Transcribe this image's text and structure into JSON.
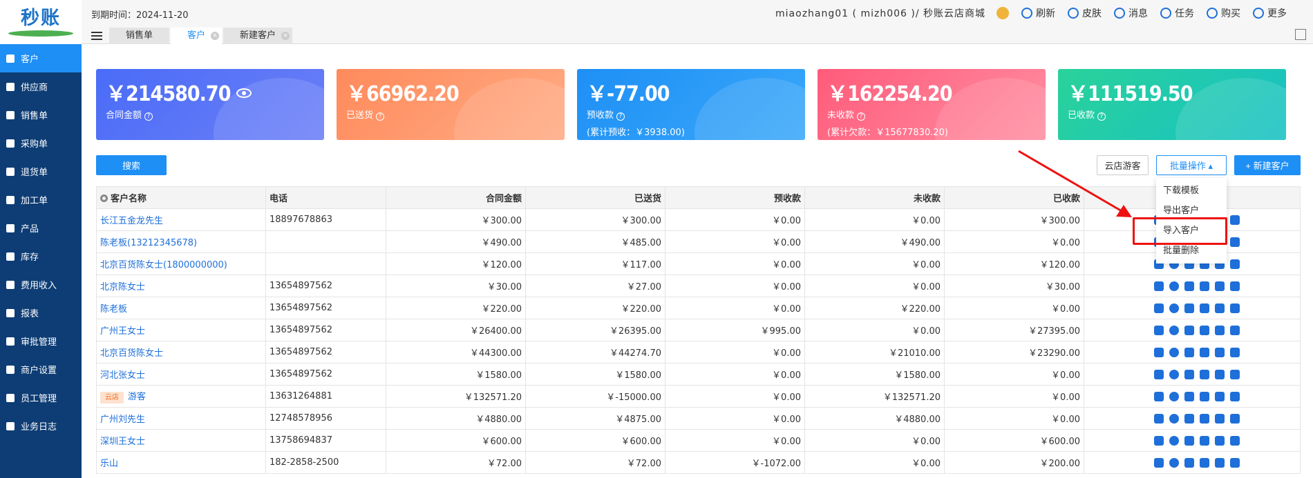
{
  "logo": {
    "text": "秒账"
  },
  "sidebar": {
    "items": [
      {
        "label": "客户",
        "active": true
      },
      {
        "label": "供应商"
      },
      {
        "label": "销售单"
      },
      {
        "label": "采购单"
      },
      {
        "label": "退货单"
      },
      {
        "label": "加工单"
      },
      {
        "label": "产品"
      },
      {
        "label": "库存"
      },
      {
        "label": "费用收入"
      },
      {
        "label": "报表"
      },
      {
        "label": "审批管理"
      },
      {
        "label": "商户设置"
      },
      {
        "label": "员工管理"
      },
      {
        "label": "业务日志"
      }
    ]
  },
  "header": {
    "expire": "到期时间：2024-11-20",
    "account": "miaozhang01 ( mizh006 )/ 秒账云店商城",
    "tools": [
      {
        "label": "刷新",
        "icon": "refresh-icon"
      },
      {
        "label": "皮肤",
        "icon": "palette-icon"
      },
      {
        "label": "消息",
        "icon": "message-icon"
      },
      {
        "label": "任务",
        "icon": "download-icon"
      },
      {
        "label": "购买",
        "icon": "cart-icon"
      },
      {
        "label": "更多",
        "icon": "user-icon"
      }
    ],
    "tabs": [
      {
        "label": "销售单"
      },
      {
        "label": "客户",
        "active": true
      },
      {
        "label": "新建客户"
      }
    ]
  },
  "cards": [
    {
      "amount": "￥214580.70",
      "label": "合同金额"
    },
    {
      "amount": "￥66962.20",
      "label": "已送货"
    },
    {
      "amount": "￥-77.00",
      "label": "预收款",
      "sub": "(累计预收：￥3938.00)"
    },
    {
      "amount": "￥162254.20",
      "label": "未收款",
      "sub": "(累计欠款：￥15677830.20)"
    },
    {
      "amount": "￥111519.50",
      "label": "已收款"
    }
  ],
  "toolbar": {
    "search": "搜索",
    "visitor": "云店游客",
    "batch": "批量操作 ▴",
    "new_customer": "+ 新建客户"
  },
  "dropdown": [
    "下载模板",
    "导出客户",
    "导入客户",
    "批量删除"
  ],
  "table": {
    "headers": [
      "客户名称",
      "电话",
      "合同金额",
      "已送货",
      "预收款",
      "未收款",
      "已收款"
    ],
    "rows": [
      {
        "name": "长江五金龙先生",
        "phone": "18897678863",
        "contract": "￥300.00",
        "delivered": "￥300.00",
        "prepaid": "￥0.00",
        "unpaid": "￥0.00",
        "paid": "￥300.00"
      },
      {
        "name": "陈老板(13212345678)",
        "phone": "",
        "contract": "￥490.00",
        "delivered": "￥485.00",
        "prepaid": "￥0.00",
        "unpaid": "￥490.00",
        "paid": "￥0.00"
      },
      {
        "name": "北京百货陈女士(1800000000)",
        "phone": "",
        "contract": "￥120.00",
        "delivered": "￥117.00",
        "prepaid": "￥0.00",
        "unpaid": "￥0.00",
        "paid": "￥120.00"
      },
      {
        "name": "北京陈女士",
        "phone": "13654897562",
        "contract": "￥30.00",
        "delivered": "￥27.00",
        "prepaid": "￥0.00",
        "unpaid": "￥0.00",
        "paid": "￥30.00"
      },
      {
        "name": "陈老板",
        "phone": "13654897562",
        "contract": "￥220.00",
        "delivered": "￥220.00",
        "prepaid": "￥0.00",
        "unpaid": "￥220.00",
        "paid": "￥0.00"
      },
      {
        "name": "广州王女士",
        "phone": "13654897562",
        "contract": "￥26400.00",
        "delivered": "￥26395.00",
        "prepaid": "￥995.00",
        "unpaid": "￥0.00",
        "paid": "￥27395.00"
      },
      {
        "name": "北京百货陈女士",
        "phone": "13654897562",
        "contract": "￥44300.00",
        "delivered": "￥44274.70",
        "prepaid": "￥0.00",
        "unpaid": "￥21010.00",
        "paid": "￥23290.00"
      },
      {
        "name": "河北张女士",
        "phone": "13654897562",
        "contract": "￥1580.00",
        "delivered": "￥1580.00",
        "prepaid": "￥0.00",
        "unpaid": "￥1580.00",
        "paid": "￥0.00"
      },
      {
        "name": "游客",
        "tag": "云店",
        "phone": "13631264881",
        "contract": "￥132571.20",
        "delivered": "￥-15000.00",
        "prepaid": "￥0.00",
        "unpaid": "￥132571.20",
        "paid": "￥0.00"
      },
      {
        "name": "广州刘先生",
        "phone": "12748578956",
        "contract": "￥4880.00",
        "delivered": "￥4875.00",
        "prepaid": "￥0.00",
        "unpaid": "￥4880.00",
        "paid": "￥0.00"
      },
      {
        "name": "深圳王女士",
        "phone": "13758694837",
        "contract": "￥600.00",
        "delivered": "￥600.00",
        "prepaid": "￥0.00",
        "unpaid": "￥0.00",
        "paid": "￥600.00"
      },
      {
        "name": "乐山",
        "phone": "182-2858-2500",
        "contract": "￥72.00",
        "delivered": "￥72.00",
        "prepaid": "￥-1072.00",
        "unpaid": "￥0.00",
        "paid": "￥200.00"
      }
    ]
  },
  "colors": {
    "primary": "#1e8ff5",
    "sidebar": "#0e3d75",
    "highlight": "#e11111"
  }
}
